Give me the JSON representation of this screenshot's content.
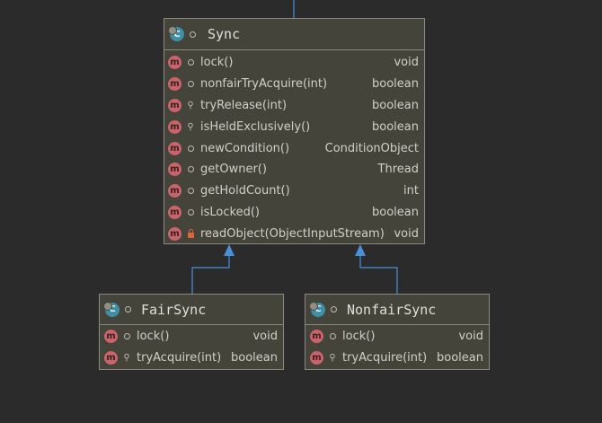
{
  "sync": {
    "icon": "C",
    "name": "Sync",
    "methods": [
      {
        "icon": "m",
        "name": "lock()",
        "type": "void",
        "visibility": "package"
      },
      {
        "icon": "m",
        "name": "nonfairTryAcquire(int)",
        "type": "boolean",
        "visibility": "package"
      },
      {
        "icon": "m",
        "name": "tryRelease(int)",
        "type": "boolean",
        "visibility": "protected"
      },
      {
        "icon": "m",
        "name": "isHeldExclusively()",
        "type": "boolean",
        "visibility": "protected"
      },
      {
        "icon": "m",
        "name": "newCondition()",
        "type": "ConditionObject",
        "visibility": "package"
      },
      {
        "icon": "m",
        "name": "getOwner()",
        "type": "Thread",
        "visibility": "package"
      },
      {
        "icon": "m",
        "name": "getHoldCount()",
        "type": "int",
        "visibility": "package"
      },
      {
        "icon": "m",
        "name": "isLocked()",
        "type": "boolean",
        "visibility": "package"
      },
      {
        "icon": "m",
        "name": "readObject(ObjectInputStream)",
        "type": "void",
        "visibility": "private"
      }
    ]
  },
  "fair": {
    "icon": "C",
    "name": "FairSync",
    "methods": [
      {
        "icon": "m",
        "name": "lock()",
        "type": "void",
        "visibility": "package"
      },
      {
        "icon": "m",
        "name": "tryAcquire(int)",
        "type": "boolean",
        "visibility": "protected"
      }
    ]
  },
  "nonfair": {
    "icon": "C",
    "name": "NonfairSync",
    "methods": [
      {
        "icon": "m",
        "name": "lock()",
        "type": "void",
        "visibility": "package"
      },
      {
        "icon": "m",
        "name": "tryAcquire(int)",
        "type": "boolean",
        "visibility": "protected"
      }
    ]
  },
  "colors": {
    "background": "#2b2b2b",
    "box": "#45443b",
    "border": "#8a8a80",
    "connector": "#4a90d9",
    "method_icon": "#c9646b",
    "class_icon": "#3f8fa6"
  },
  "icons": {
    "class": "class-icon",
    "method": "method-icon",
    "package": "package-visibility-icon",
    "protected": "protected-visibility-icon",
    "private": "private-lock-icon"
  }
}
